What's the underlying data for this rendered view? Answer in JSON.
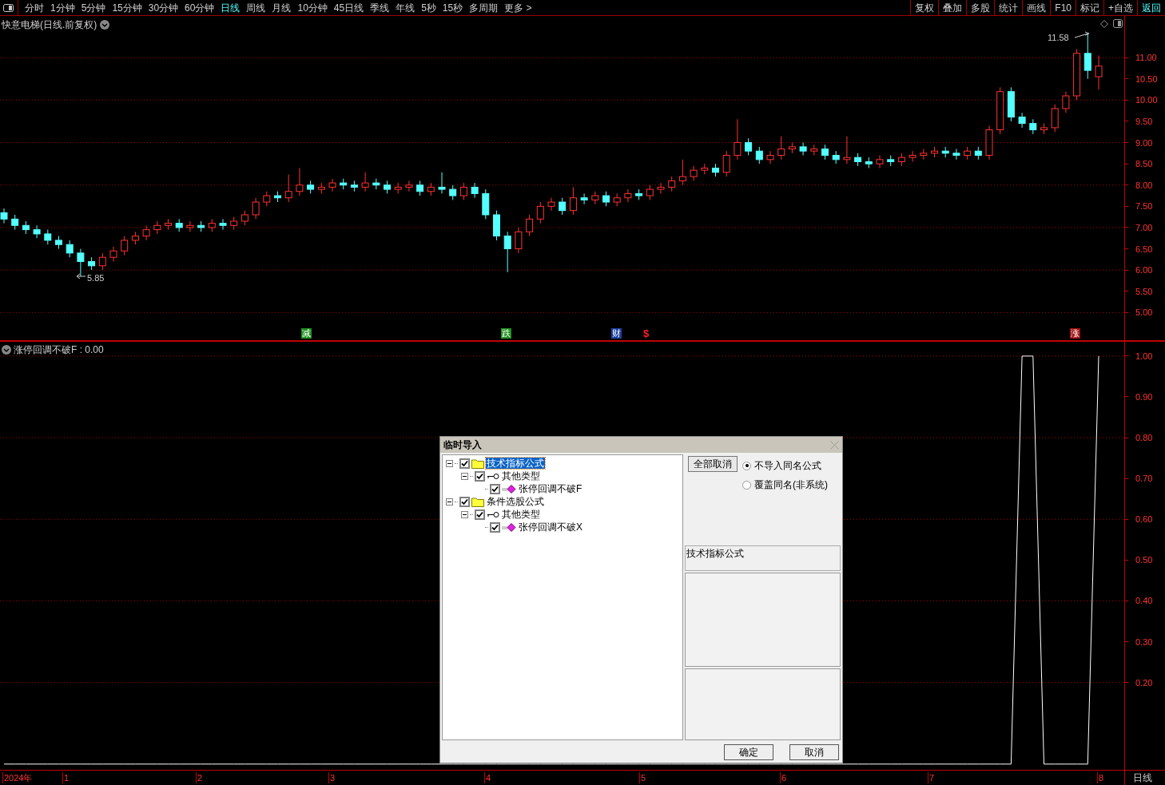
{
  "toolbar": {
    "periods": [
      {
        "label": "分时",
        "selected": false
      },
      {
        "label": "1分钟",
        "selected": false
      },
      {
        "label": "5分钟",
        "selected": false
      },
      {
        "label": "15分钟",
        "selected": false
      },
      {
        "label": "30分钟",
        "selected": false
      },
      {
        "label": "60分钟",
        "selected": false
      },
      {
        "label": "日线",
        "selected": true
      },
      {
        "label": "周线",
        "selected": false
      },
      {
        "label": "月线",
        "selected": false
      },
      {
        "label": "10分钟",
        "selected": false
      },
      {
        "label": "45日线",
        "selected": false
      },
      {
        "label": "季线",
        "selected": false
      },
      {
        "label": "年线",
        "selected": false
      },
      {
        "label": "5秒",
        "selected": false
      },
      {
        "label": "15秒",
        "selected": false
      },
      {
        "label": "多周期",
        "selected": false
      },
      {
        "label": "更多 >",
        "selected": false
      }
    ],
    "actions": [
      {
        "label": "复权",
        "highlighted": false
      },
      {
        "label": "叠加",
        "highlighted": false
      },
      {
        "label": "多股",
        "highlighted": false
      },
      {
        "label": "统计",
        "highlighted": false
      },
      {
        "label": "画线",
        "highlighted": false
      },
      {
        "label": "F10",
        "highlighted": false
      },
      {
        "label": "标记",
        "highlighted": false
      },
      {
        "label": "+自选",
        "highlighted": false
      },
      {
        "label": "返回",
        "highlighted": true
      }
    ]
  },
  "price_chart": {
    "title": "快意电梯(日线.前复权)",
    "high_label": "11.58",
    "low_label": "5.85",
    "chart_data": {
      "type": "candlestick",
      "ylim": [
        4.33,
        11.98
      ],
      "grid": true,
      "yticks": [
        {
          "value": 11,
          "label": "11.00"
        },
        {
          "value": 10.5,
          "label": "10.50"
        },
        {
          "value": 10,
          "label": "10.00"
        },
        {
          "value": 9.5,
          "label": "9.50"
        },
        {
          "value": 9,
          "label": "9.00"
        },
        {
          "value": 8.5,
          "label": "8.50"
        },
        {
          "value": 8,
          "label": "8.00"
        },
        {
          "value": 7.5,
          "label": "7.50"
        },
        {
          "value": 7,
          "label": "7.00"
        },
        {
          "value": 6.5,
          "label": "6.50"
        },
        {
          "value": 6,
          "label": "6.00"
        },
        {
          "value": 5.5,
          "label": "5.50"
        },
        {
          "value": 5,
          "label": "5.00"
        }
      ],
      "ohlc": [
        [
          7.35,
          7.45,
          7.1,
          7.2
        ],
        [
          7.2,
          7.3,
          6.95,
          7.05
        ],
        [
          7.05,
          7.15,
          6.85,
          6.95
        ],
        [
          6.95,
          7.05,
          6.75,
          6.85
        ],
        [
          6.85,
          6.95,
          6.6,
          6.7
        ],
        [
          6.7,
          6.8,
          6.5,
          6.6
        ],
        [
          6.6,
          6.7,
          6.3,
          6.4
        ],
        [
          6.4,
          6.5,
          5.85,
          6.2
        ],
        [
          6.2,
          6.3,
          6.0,
          6.1
        ],
        [
          6.1,
          6.4,
          6.0,
          6.3
        ],
        [
          6.3,
          6.55,
          6.2,
          6.45
        ],
        [
          6.45,
          6.8,
          6.35,
          6.7
        ],
        [
          6.7,
          6.9,
          6.6,
          6.8
        ],
        [
          6.8,
          7.05,
          6.7,
          6.95
        ],
        [
          6.95,
          7.15,
          6.85,
          7.05
        ],
        [
          7.05,
          7.2,
          6.95,
          7.1
        ],
        [
          7.1,
          7.2,
          6.9,
          7.0
        ],
        [
          7.0,
          7.15,
          6.9,
          7.05
        ],
        [
          7.05,
          7.15,
          6.9,
          7.0
        ],
        [
          7.0,
          7.2,
          6.9,
          7.1
        ],
        [
          7.1,
          7.2,
          6.95,
          7.05
        ],
        [
          7.05,
          7.25,
          6.95,
          7.15
        ],
        [
          7.15,
          7.4,
          7.05,
          7.3
        ],
        [
          7.3,
          7.7,
          7.2,
          7.6
        ],
        [
          7.6,
          7.85,
          7.5,
          7.75
        ],
        [
          7.75,
          7.85,
          7.6,
          7.7
        ],
        [
          7.7,
          8.25,
          7.6,
          7.85
        ],
        [
          7.85,
          8.4,
          7.75,
          8.0
        ],
        [
          8.0,
          8.1,
          7.8,
          7.9
        ],
        [
          7.9,
          8.05,
          7.8,
          7.95
        ],
        [
          7.95,
          8.15,
          7.85,
          8.05
        ],
        [
          8.05,
          8.15,
          7.9,
          8.0
        ],
        [
          8.0,
          8.1,
          7.85,
          7.95
        ],
        [
          7.95,
          8.3,
          7.85,
          8.05
        ],
        [
          8.05,
          8.15,
          7.9,
          8.0
        ],
        [
          8.0,
          8.1,
          7.8,
          7.9
        ],
        [
          7.9,
          8.05,
          7.8,
          7.95
        ],
        [
          7.95,
          8.1,
          7.85,
          8.0
        ],
        [
          8.0,
          8.1,
          7.75,
          7.85
        ],
        [
          7.85,
          8.05,
          7.75,
          7.95
        ],
        [
          7.95,
          8.3,
          7.8,
          7.9
        ],
        [
          7.9,
          8.0,
          7.65,
          7.75
        ],
        [
          7.75,
          8.05,
          7.65,
          7.95
        ],
        [
          7.95,
          8.05,
          7.7,
          7.8
        ],
        [
          7.8,
          7.9,
          7.2,
          7.3
        ],
        [
          7.3,
          7.4,
          6.7,
          6.8
        ],
        [
          6.8,
          6.9,
          5.95,
          6.5
        ],
        [
          6.5,
          7.0,
          6.4,
          6.9
        ],
        [
          6.9,
          7.3,
          6.8,
          7.2
        ],
        [
          7.2,
          7.6,
          7.1,
          7.5
        ],
        [
          7.5,
          7.7,
          7.4,
          7.6
        ],
        [
          7.6,
          7.7,
          7.3,
          7.4
        ],
        [
          7.4,
          7.95,
          7.3,
          7.7
        ],
        [
          7.7,
          7.8,
          7.55,
          7.65
        ],
        [
          7.65,
          7.85,
          7.55,
          7.75
        ],
        [
          7.75,
          7.85,
          7.5,
          7.6
        ],
        [
          7.6,
          7.8,
          7.5,
          7.7
        ],
        [
          7.7,
          7.9,
          7.6,
          7.8
        ],
        [
          7.8,
          7.9,
          7.65,
          7.75
        ],
        [
          7.75,
          8.0,
          7.65,
          7.9
        ],
        [
          7.9,
          8.05,
          7.8,
          7.95
        ],
        [
          7.95,
          8.2,
          7.85,
          8.1
        ],
        [
          8.1,
          8.6,
          8.0,
          8.2
        ],
        [
          8.2,
          8.45,
          8.1,
          8.35
        ],
        [
          8.35,
          8.5,
          8.25,
          8.4
        ],
        [
          8.4,
          8.5,
          8.2,
          8.3
        ],
        [
          8.3,
          8.8,
          8.2,
          8.7
        ],
        [
          8.7,
          9.55,
          8.6,
          9.0
        ],
        [
          9.0,
          9.1,
          8.7,
          8.8
        ],
        [
          8.8,
          8.9,
          8.5,
          8.6
        ],
        [
          8.6,
          8.8,
          8.5,
          8.7
        ],
        [
          8.7,
          9.15,
          8.6,
          8.85
        ],
        [
          8.85,
          9.0,
          8.75,
          8.9
        ],
        [
          8.9,
          9.0,
          8.7,
          8.8
        ],
        [
          8.8,
          8.95,
          8.7,
          8.85
        ],
        [
          8.85,
          8.95,
          8.6,
          8.7
        ],
        [
          8.7,
          8.8,
          8.5,
          8.6
        ],
        [
          8.6,
          9.15,
          8.5,
          8.65
        ],
        [
          8.65,
          8.75,
          8.45,
          8.55
        ],
        [
          8.55,
          8.65,
          8.4,
          8.5
        ],
        [
          8.5,
          8.7,
          8.4,
          8.6
        ],
        [
          8.6,
          8.7,
          8.45,
          8.55
        ],
        [
          8.55,
          8.75,
          8.45,
          8.65
        ],
        [
          8.65,
          8.8,
          8.55,
          8.7
        ],
        [
          8.7,
          8.85,
          8.6,
          8.75
        ],
        [
          8.75,
          8.9,
          8.65,
          8.8
        ],
        [
          8.8,
          8.9,
          8.65,
          8.75
        ],
        [
          8.75,
          8.85,
          8.6,
          8.7
        ],
        [
          8.7,
          8.9,
          8.6,
          8.8
        ],
        [
          8.8,
          8.9,
          8.6,
          8.7
        ],
        [
          8.7,
          9.4,
          8.6,
          9.3
        ],
        [
          9.3,
          10.3,
          9.2,
          10.2
        ],
        [
          10.2,
          10.3,
          9.5,
          9.6
        ],
        [
          9.6,
          9.7,
          9.35,
          9.45
        ],
        [
          9.45,
          9.55,
          9.2,
          9.3
        ],
        [
          9.3,
          9.45,
          9.2,
          9.35
        ],
        [
          9.35,
          9.9,
          9.25,
          9.8
        ],
        [
          9.8,
          10.2,
          9.7,
          10.1
        ],
        [
          10.1,
          11.2,
          10.0,
          11.1
        ],
        [
          11.1,
          11.58,
          10.5,
          10.7
        ],
        [
          10.55,
          11.05,
          10.25,
          10.8
        ]
      ]
    },
    "markers": [
      {
        "text": "减",
        "kind": "badge",
        "color": "#1f8f1f"
      },
      {
        "text": "跌",
        "kind": "badge",
        "color": "#1f8f1f"
      },
      {
        "text": "财",
        "kind": "badge",
        "color": "#1f3fa0"
      },
      {
        "text": "$",
        "kind": "text",
        "color": "#ff2020"
      },
      {
        "text": "涨",
        "kind": "badge",
        "color": "#a01010"
      }
    ]
  },
  "indicator_chart": {
    "title": "涨停回调不破F : 0.00",
    "chart_data": {
      "type": "line",
      "ylim": [
        -0.016,
        1.035
      ],
      "grid": true,
      "yticks": [
        {
          "value": 1,
          "label": "1.00"
        },
        {
          "value": 0.9,
          "label": "0.90"
        },
        {
          "value": 0.8,
          "label": "0.80"
        },
        {
          "value": 0.7,
          "label": "0.70"
        },
        {
          "value": 0.6,
          "label": "0.60"
        },
        {
          "value": 0.5,
          "label": "0.50"
        },
        {
          "value": 0.4,
          "label": "0.40"
        },
        {
          "value": 0.3,
          "label": "0.30"
        },
        {
          "value": 0.2,
          "label": "0.20"
        }
      ],
      "values": [
        0,
        0,
        0,
        0,
        0,
        0,
        0,
        0,
        0,
        0,
        0,
        0,
        0,
        0,
        0,
        0,
        0,
        0,
        0,
        0,
        0,
        0,
        0,
        0,
        0,
        0,
        0,
        0,
        0,
        0,
        0,
        0,
        0,
        0,
        0,
        0,
        0,
        0,
        0,
        0,
        0,
        0,
        0,
        0,
        0,
        0,
        0,
        0,
        0,
        0,
        0,
        0,
        0,
        0,
        0,
        0,
        0,
        0,
        0,
        0,
        0,
        0,
        0,
        0,
        0,
        0,
        0,
        0,
        0,
        0,
        0,
        0,
        0,
        0,
        0,
        0,
        0,
        0,
        0,
        0,
        0,
        0,
        0,
        0,
        0,
        0,
        0,
        0,
        0,
        0,
        0,
        0,
        0,
        1,
        1,
        0,
        0,
        0,
        0,
        0,
        1
      ]
    }
  },
  "time_axis": {
    "labels": [
      "2024年",
      "1",
      "2",
      "3",
      "4",
      "5",
      "6",
      "7",
      "8"
    ],
    "period": "日线"
  },
  "dialog": {
    "title": "临时导入",
    "tree": [
      {
        "label": "技术指标公式",
        "kind": "folder",
        "checked": true,
        "expanded": true,
        "selected": true,
        "children": [
          {
            "label": "其他类型",
            "kind": "group",
            "checked": true,
            "expanded": true,
            "selected": false,
            "children": [
              {
                "label": "张停回调不破F",
                "kind": "formula",
                "checked": true,
                "selected": false
              }
            ]
          }
        ]
      },
      {
        "label": "条件选股公式",
        "kind": "folder",
        "checked": true,
        "expanded": true,
        "selected": false,
        "children": [
          {
            "label": "其他类型",
            "kind": "group",
            "checked": true,
            "expanded": true,
            "selected": false,
            "children": [
              {
                "label": "张停回调不破X",
                "kind": "formula",
                "checked": true,
                "selected": false
              }
            ]
          }
        ]
      }
    ],
    "deselect_button": "全部取消",
    "options": [
      {
        "label": "不导入同名公式",
        "selected": true
      },
      {
        "label": "覆盖同名(非系统)",
        "selected": false
      }
    ],
    "info_label": "技术指标公式",
    "buttons": [
      "确定",
      "取消"
    ]
  }
}
